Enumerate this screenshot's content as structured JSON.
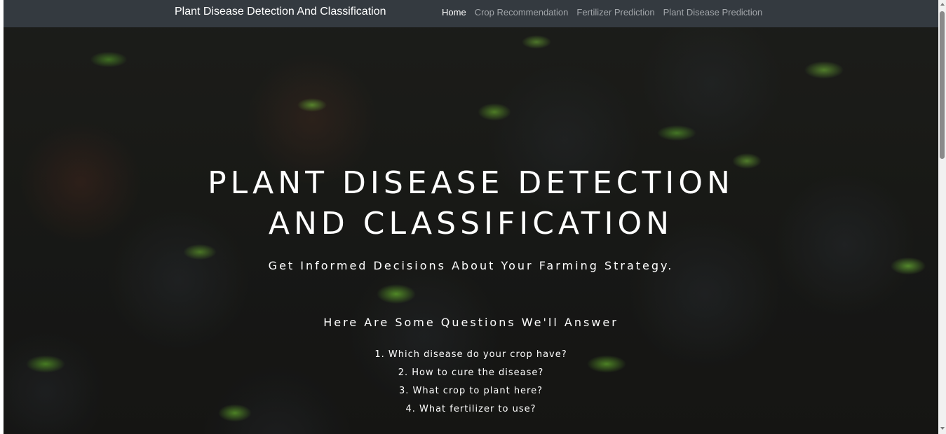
{
  "navbar": {
    "brand": "Plant Disease Detection And Classification",
    "links": [
      {
        "label": "Home",
        "active": true
      },
      {
        "label": "Crop Recommendation",
        "active": false
      },
      {
        "label": "Fertilizer Prediction",
        "active": false
      },
      {
        "label": "Plant Disease Prediction",
        "active": false
      }
    ]
  },
  "hero": {
    "title_line1": "PLANT DISEASE DETECTION",
    "title_line2": "AND CLASSIFICATION",
    "subtitle": "Get Informed Decisions About Your Farming Strategy.",
    "questions_heading": "Here Are Some Questions We'll Answer",
    "questions": [
      "1. Which disease do your crop have?",
      "2. How to cure the disease?",
      "3. What crop to plant here?",
      "4. What fertilizer to use?"
    ]
  },
  "colors": {
    "navbar_bg": "#343a40",
    "nav_active": "#ffffff",
    "nav_inactive": "#a2a6aa",
    "hero_text": "#ffffff"
  },
  "icons": {
    "scroll_up": "chevron-up-icon",
    "scroll_down": "chevron-down-icon"
  }
}
